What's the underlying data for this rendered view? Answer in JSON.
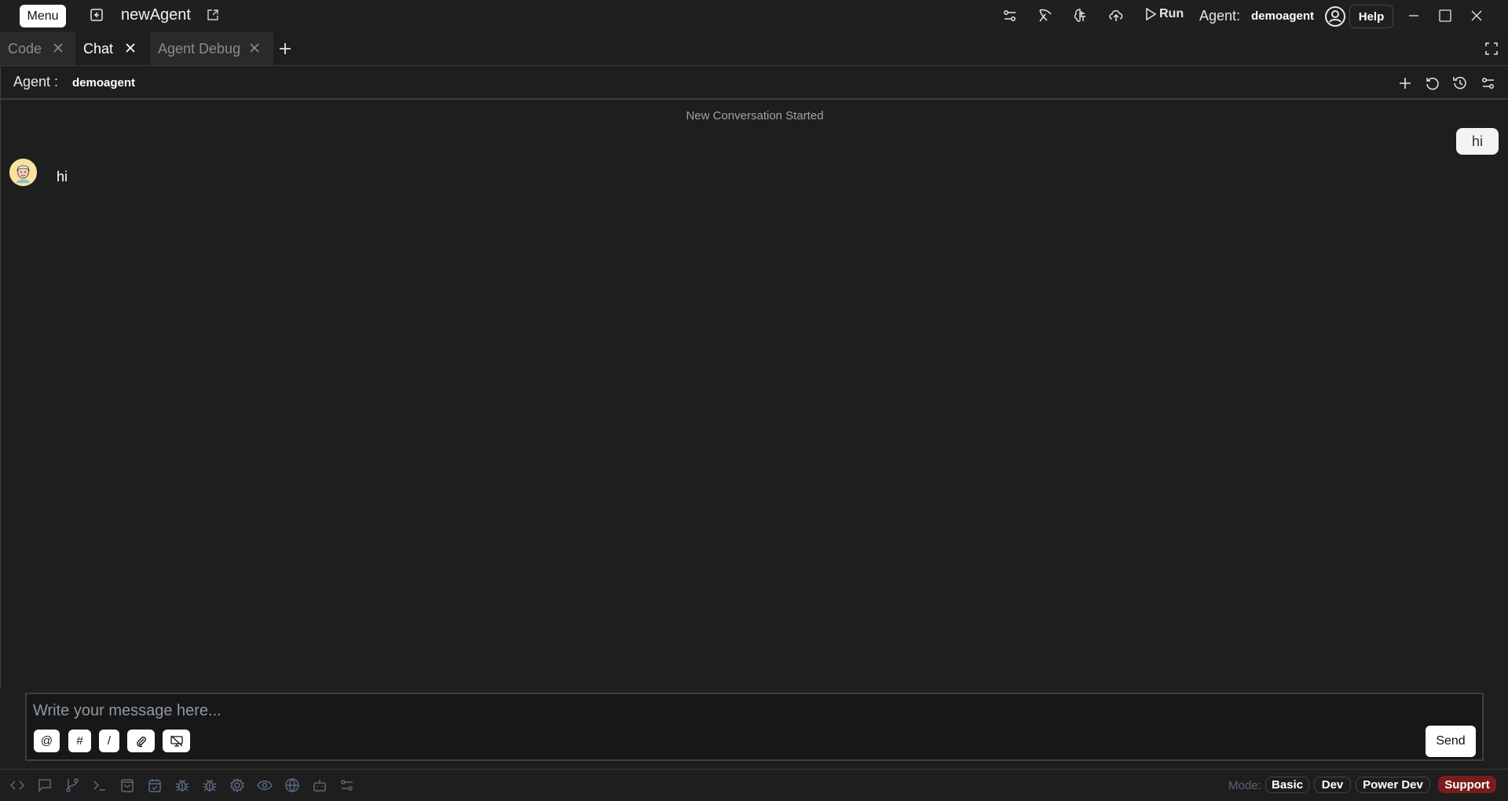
{
  "titlebar": {
    "menu_label": "Menu",
    "app_title": "newAgent",
    "run_label": "Run",
    "agent_label": "Agent:",
    "agent_value": "demoagent",
    "help_label": "Help",
    "icons": [
      "back-icon",
      "open-external-icon",
      "settings-sliders-icon",
      "deploy-pickaxe-icon",
      "brain-icon",
      "cloud-upload-icon",
      "play-icon",
      "user-circle-icon",
      "minimize-icon",
      "maximize-icon",
      "close-icon"
    ]
  },
  "tabs": [
    {
      "label": "Code",
      "active": false
    },
    {
      "label": "Chat",
      "active": true
    },
    {
      "label": "Agent Debug",
      "active": false
    }
  ],
  "agent_bar": {
    "label": "Agent :",
    "value": "demoagent",
    "icons": [
      "new-chat-icon",
      "reset-icon",
      "history-icon",
      "settings-sliders-icon"
    ]
  },
  "conversation": {
    "system_message": "New Conversation Started",
    "messages": [
      {
        "role": "user",
        "text": "hi"
      },
      {
        "role": "assistant",
        "text": "hi"
      }
    ]
  },
  "composer": {
    "placeholder": "Write your message here...",
    "value": "",
    "chips": [
      "@",
      "#",
      "/"
    ],
    "chip_icons": [
      "paperclip-icon",
      "screen-off-icon"
    ],
    "send_label": "Send"
  },
  "statusbar": {
    "icons": [
      "code-icon",
      "chat-icon",
      "git-branch-icon",
      "terminal-icon",
      "bag-icon",
      "calendar-check-icon",
      "bug-icon",
      "bug-alt-icon",
      "gear-icon",
      "eye-icon",
      "globe-icon",
      "robot-icon",
      "sliders-icon"
    ],
    "mode_label": "Mode:",
    "modes": [
      "Basic",
      "Dev",
      "Power Dev"
    ],
    "support_label": "Support",
    "support_color": "#7a1c1c"
  }
}
